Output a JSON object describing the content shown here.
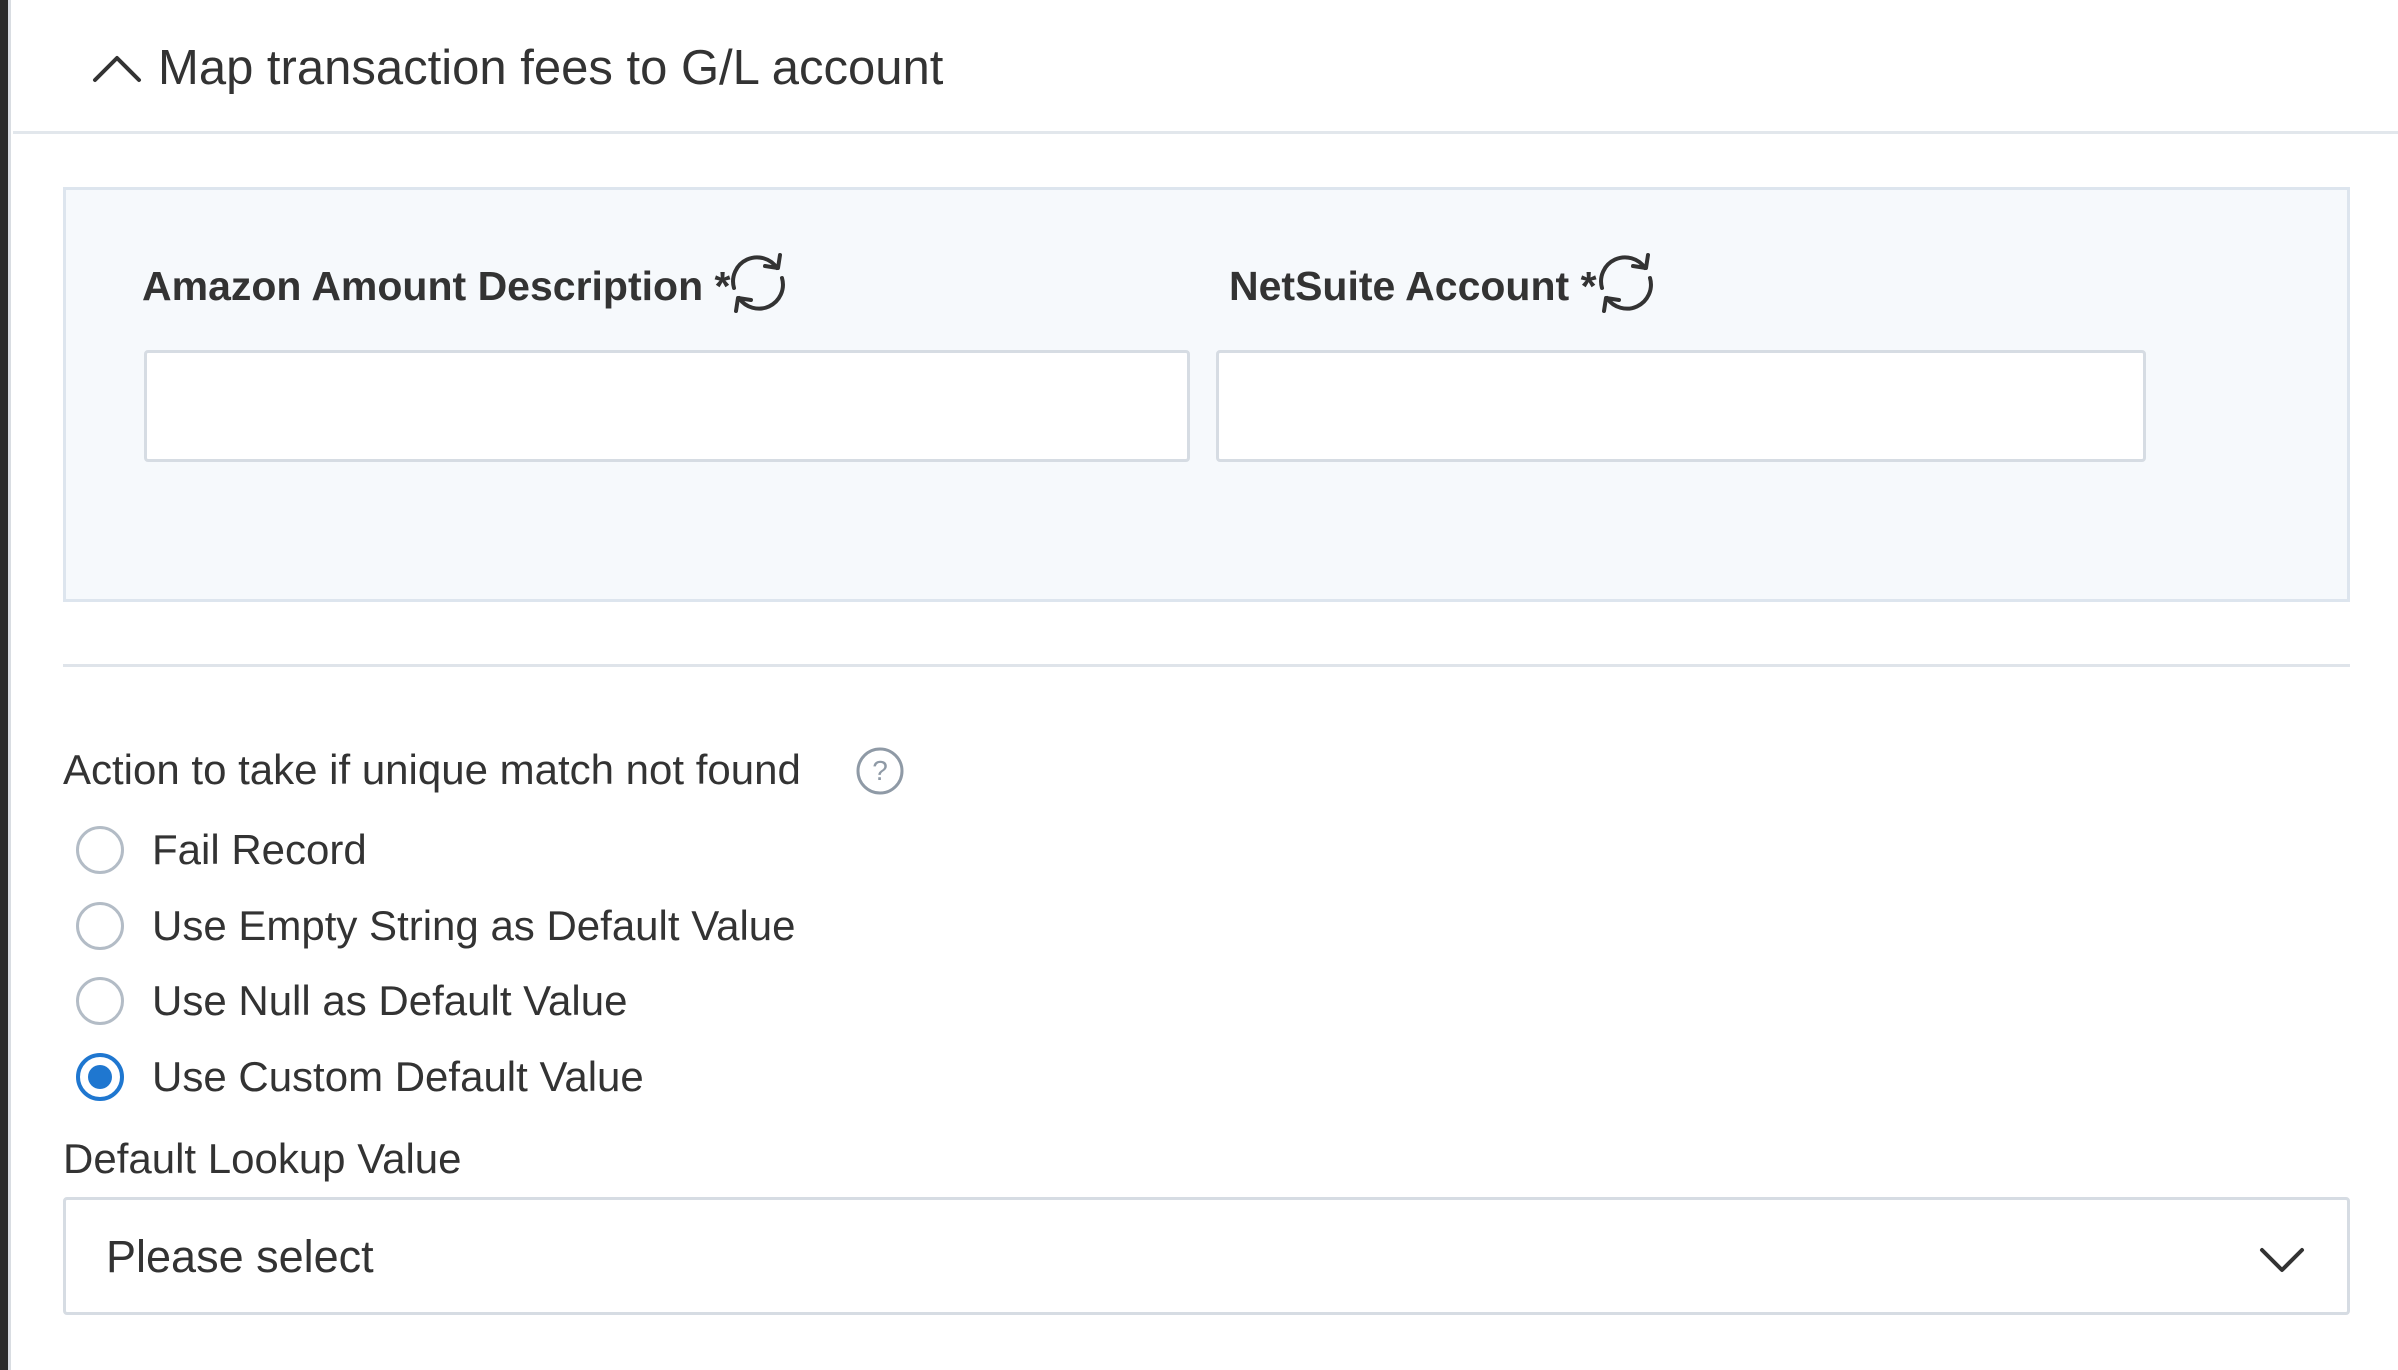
{
  "section": {
    "title": "Map transaction fees to G/L account",
    "collapse_icon": "chevron-up-icon"
  },
  "mapping": {
    "amazon_field": {
      "label": "Amazon Amount Description *",
      "value": "",
      "icon": "refresh-icon"
    },
    "netsuite_field": {
      "label": "NetSuite Account *",
      "value": "",
      "icon": "refresh-icon"
    }
  },
  "unique_match": {
    "label": "Action to take if unique match not found",
    "help_icon": "question-circle-icon",
    "options": [
      {
        "label": "Fail Record",
        "checked": false
      },
      {
        "label": "Use Empty String as Default Value",
        "checked": false
      },
      {
        "label": "Use Null as Default Value",
        "checked": false
      },
      {
        "label": "Use Custom Default Value",
        "checked": true
      }
    ]
  },
  "default_lookup": {
    "label": "Default Lookup Value",
    "selected": "Please select",
    "icon": "chevron-down-icon"
  },
  "colors": {
    "accent": "#1f77d0",
    "panel_background": "#f6f9fc",
    "border": "#d6dce3",
    "text": "#333333"
  }
}
